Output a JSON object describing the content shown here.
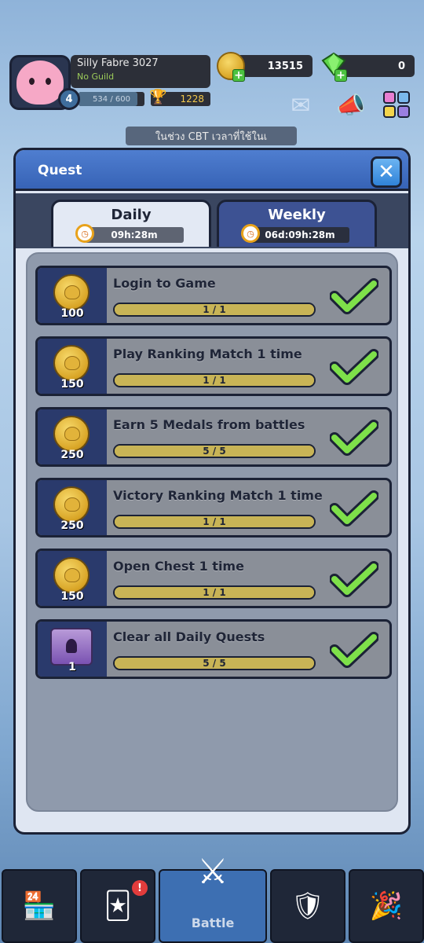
{
  "player": {
    "name": "Silly Fabre 3027",
    "guild": "No Guild",
    "level": "4",
    "xp_text": "534 / 600",
    "xp_fraction": 0.89,
    "trophies": "1228"
  },
  "currency": {
    "coins": "13515",
    "gems": "0"
  },
  "banner_text": "ในช่วง CBT เวลาที่ใช้ในเ",
  "quest_modal": {
    "title": "Quest",
    "close_icon": "close-x-icon",
    "tabs": [
      {
        "label": "Daily",
        "timer": "09h:28m",
        "active": true
      },
      {
        "label": "Weekly",
        "timer": "06d:09h:28m",
        "active": false
      }
    ],
    "quests": [
      {
        "title": "Login to Game",
        "reward_type": "coin",
        "reward": "100",
        "progress_text": "1 / 1",
        "progress": 1.0,
        "completed": true
      },
      {
        "title": "Play Ranking Match 1 time",
        "reward_type": "coin",
        "reward": "150",
        "progress_text": "1 / 1",
        "progress": 1.0,
        "completed": true
      },
      {
        "title": "Earn 5 Medals from battles",
        "reward_type": "coin",
        "reward": "250",
        "progress_text": "5 / 5",
        "progress": 1.0,
        "completed": true
      },
      {
        "title": "Victory Ranking Match 1 time",
        "reward_type": "coin",
        "reward": "250",
        "progress_text": "1 / 1",
        "progress": 1.0,
        "completed": true
      },
      {
        "title": "Open Chest 1 time",
        "reward_type": "coin",
        "reward": "150",
        "progress_text": "1 / 1",
        "progress": 1.0,
        "completed": true
      },
      {
        "title": "Clear all Daily Quests",
        "reward_type": "chest",
        "reward": "1",
        "progress_text": "5 / 5",
        "progress": 1.0,
        "completed": true
      }
    ]
  },
  "nav": {
    "battle_label": "Battle",
    "notification": "!"
  },
  "colors": {
    "header_blue": "#3763b6",
    "check_green": "#7ee04a",
    "reward_bg": "#2a3a6c",
    "progress_gold": "#c8b456"
  }
}
